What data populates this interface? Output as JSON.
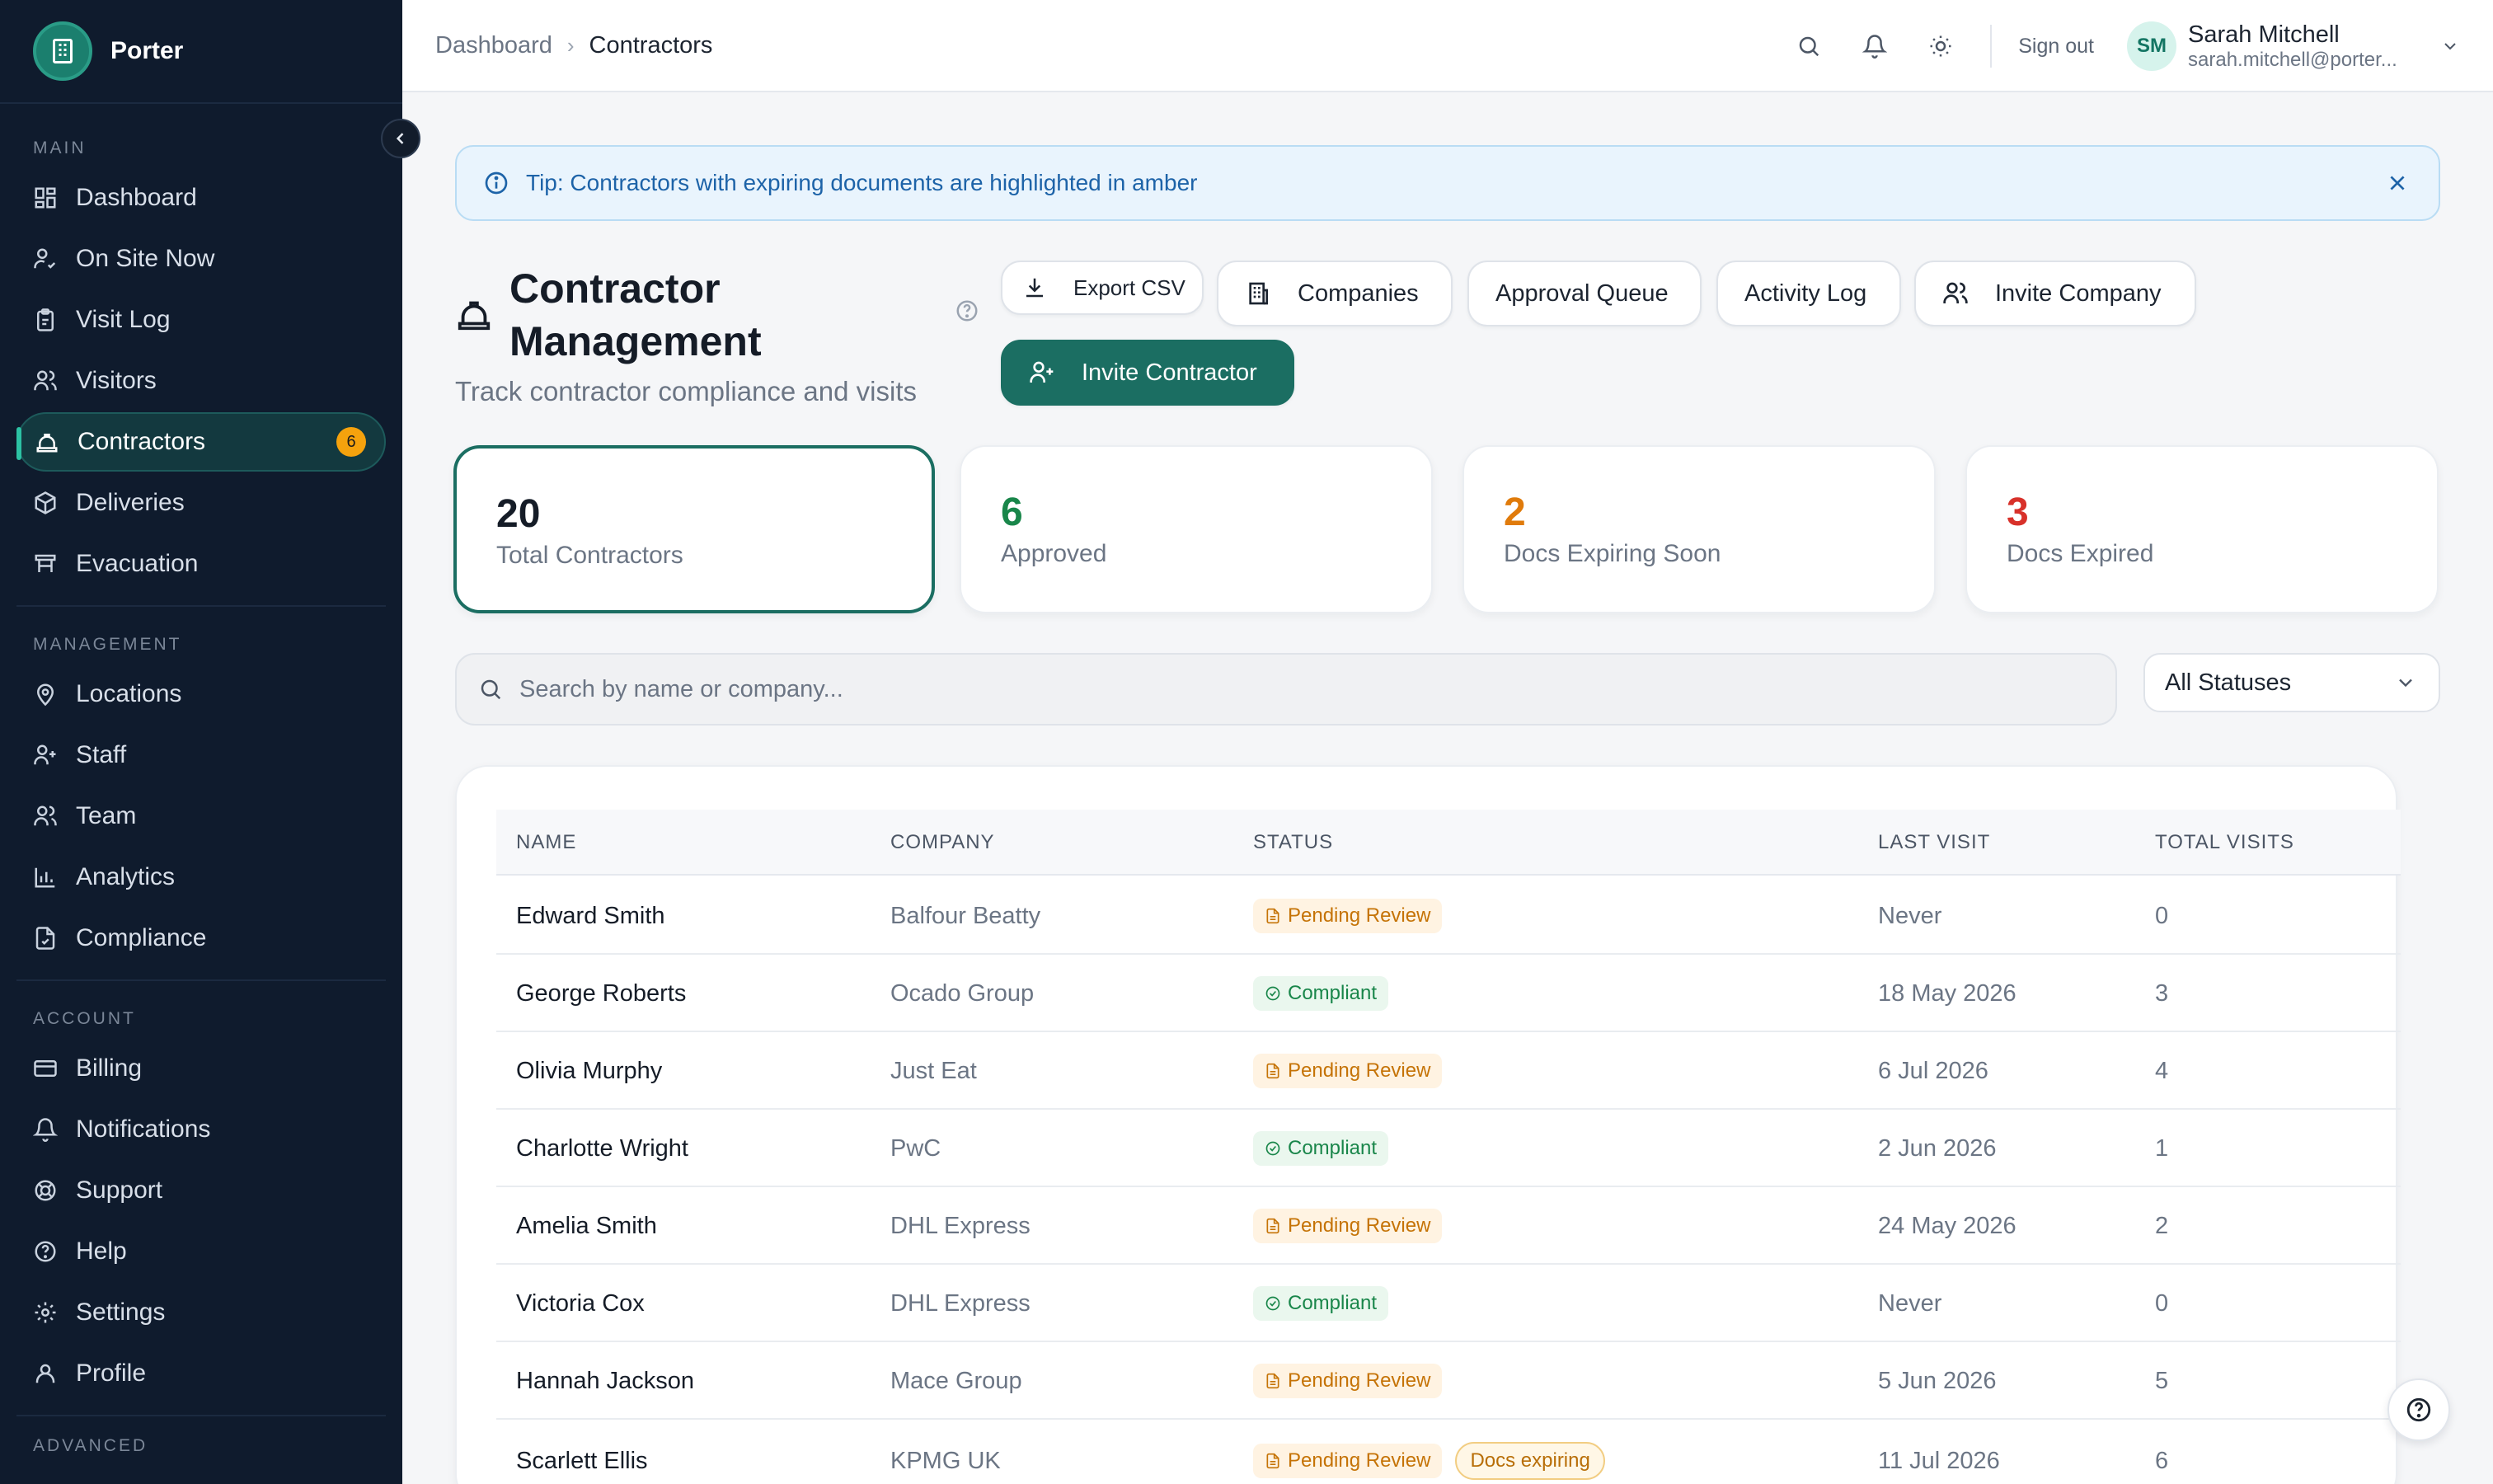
{
  "brand": {
    "name": "Porter"
  },
  "sidebar": {
    "sections": [
      {
        "title": "MAIN",
        "items": [
          {
            "label": "Dashboard",
            "icon": "dashboard-icon"
          },
          {
            "label": "On Site Now",
            "icon": "user-check-icon"
          },
          {
            "label": "Visit Log",
            "icon": "clipboard-icon"
          },
          {
            "label": "Visitors",
            "icon": "users-icon"
          },
          {
            "label": "Contractors",
            "icon": "hard-hat-icon",
            "active": true,
            "badge": "6"
          },
          {
            "label": "Deliveries",
            "icon": "package-icon"
          },
          {
            "label": "Evacuation",
            "icon": "evacuation-icon"
          }
        ]
      },
      {
        "title": "MANAGEMENT",
        "items": [
          {
            "label": "Locations",
            "icon": "map-pin-icon"
          },
          {
            "label": "Staff",
            "icon": "user-plus-icon"
          },
          {
            "label": "Team",
            "icon": "team-icon"
          },
          {
            "label": "Analytics",
            "icon": "bar-chart-icon"
          },
          {
            "label": "Compliance",
            "icon": "file-check-icon"
          }
        ]
      },
      {
        "title": "ACCOUNT",
        "items": [
          {
            "label": "Billing",
            "icon": "credit-card-icon"
          },
          {
            "label": "Notifications",
            "icon": "bell-icon"
          },
          {
            "label": "Support",
            "icon": "lifebuoy-icon"
          },
          {
            "label": "Help",
            "icon": "help-circle-icon"
          },
          {
            "label": "Settings",
            "icon": "gear-icon"
          },
          {
            "label": "Profile",
            "icon": "user-icon"
          }
        ]
      },
      {
        "title": "ADVANCED",
        "items": []
      }
    ]
  },
  "topbar": {
    "breadcrumb": {
      "parent": "Dashboard",
      "current": "Contractors"
    },
    "signout": "Sign out",
    "user": {
      "initials": "SM",
      "name": "Sarah Mitchell",
      "email": "sarah.mitchell@porter..."
    }
  },
  "tip": {
    "text": "Tip: Contractors with expiring documents are highlighted in amber"
  },
  "header": {
    "title": "Contractor Management",
    "subtitle": "Track contractor compliance and visits"
  },
  "actions": {
    "export": "Export CSV",
    "companies": "Companies",
    "approval": "Approval Queue",
    "activity": "Activity Log",
    "invite_company": "Invite Company",
    "invite_contractor": "Invite Contractor"
  },
  "stats": [
    {
      "value": "20",
      "label": "Total Contractors",
      "color": "#151c27"
    },
    {
      "value": "6",
      "label": "Approved",
      "color": "#19864a"
    },
    {
      "value": "2",
      "label": "Docs Expiring Soon",
      "color": "#e07b0b"
    },
    {
      "value": "3",
      "label": "Docs Expired",
      "color": "#d8312a"
    }
  ],
  "search": {
    "placeholder": "Search by name or company..."
  },
  "filter": {
    "selected": "All Statuses"
  },
  "table": {
    "columns": [
      "NAME",
      "COMPANY",
      "STATUS",
      "LAST VISIT",
      "TOTAL VISITS"
    ],
    "rows": [
      {
        "name": "Edward Smith",
        "company": "Balfour Beatty",
        "status": "Pending Review",
        "last_visit": "Never",
        "visits": "0"
      },
      {
        "name": "George Roberts",
        "company": "Ocado Group",
        "status": "Compliant",
        "last_visit": "18 May 2026",
        "visits": "3"
      },
      {
        "name": "Olivia Murphy",
        "company": "Just Eat",
        "status": "Pending Review",
        "last_visit": "6 Jul 2026",
        "visits": "4"
      },
      {
        "name": "Charlotte Wright",
        "company": "PwC",
        "status": "Compliant",
        "last_visit": "2 Jun 2026",
        "visits": "1"
      },
      {
        "name": "Amelia Smith",
        "company": "DHL Express",
        "status": "Pending Review",
        "last_visit": "24 May 2026",
        "visits": "2"
      },
      {
        "name": "Victoria Cox",
        "company": "DHL Express",
        "status": "Compliant",
        "last_visit": "Never",
        "visits": "0"
      },
      {
        "name": "Hannah Jackson",
        "company": "Mace Group",
        "status": "Pending Review",
        "last_visit": "5 Jun 2026",
        "visits": "5"
      },
      {
        "name": "Scarlett Ellis",
        "company": "KPMG UK",
        "status": "Pending Review",
        "extra_badge": "Docs expiring",
        "last_visit": "11 Jul 2026",
        "visits": "6"
      }
    ]
  },
  "colors": {
    "accent": "#1b6e62",
    "sidebar": "#0f1b2d",
    "pending": "#c57306",
    "compliant": "#19864a"
  }
}
